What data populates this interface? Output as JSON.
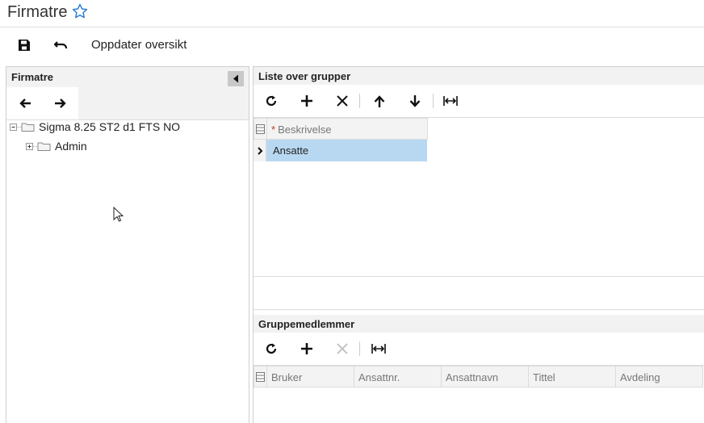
{
  "page": {
    "title": "Firmatre"
  },
  "toolbar": {
    "refresh_label": "Oppdater oversikt"
  },
  "left_panel": {
    "title": "Firmatre",
    "tree": [
      {
        "label": "Sigma 8.25 ST2 d1 FTS NO",
        "expanded": true
      },
      {
        "label": "Admin",
        "expanded": false
      }
    ]
  },
  "groups_section": {
    "title": "Liste over grupper",
    "columns": [
      {
        "label": "Beskrivelse",
        "required": true
      }
    ],
    "rows": [
      {
        "beskrivelse": "Ansatte",
        "selected": true
      }
    ]
  },
  "members_section": {
    "title": "Gruppemedlemmer",
    "columns": [
      {
        "label": "Bruker"
      },
      {
        "label": "Ansattnr."
      },
      {
        "label": "Ansattnavn"
      },
      {
        "label": "Tittel"
      },
      {
        "label": "Avdeling"
      }
    ]
  },
  "colors": {
    "selected_row": "#b8d8f2",
    "header_bg": "#f2f2f2",
    "star": "#2b7cd3"
  }
}
